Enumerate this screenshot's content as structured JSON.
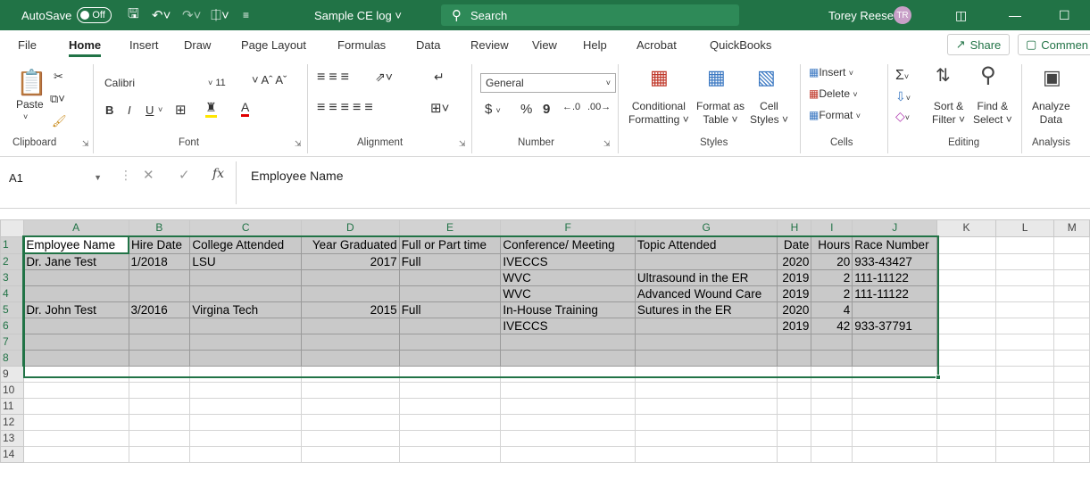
{
  "titlebar": {
    "autosave_label": "AutoSave",
    "autosave_state": "Off",
    "doc_title": "Sample CE log",
    "search_placeholder": "Search",
    "user_name": "Torey Reese",
    "user_initials": "TR"
  },
  "tabs": [
    "File",
    "Home",
    "Insert",
    "Draw",
    "Page Layout",
    "Formulas",
    "Data",
    "Review",
    "View",
    "Help",
    "Acrobat",
    "QuickBooks"
  ],
  "active_tab": "Home",
  "share_label": "Share",
  "comments_label": "Commen",
  "ribbon": {
    "clipboard": {
      "paste": "Paste",
      "label": "Clipboard"
    },
    "font": {
      "name": "Calibri",
      "size": "11",
      "label": "Font",
      "bold": "B",
      "italic": "I",
      "underline": "U"
    },
    "alignment": {
      "label": "Alignment"
    },
    "number": {
      "format": "General",
      "label": "Number",
      "currency": "$",
      "percent": "%",
      "comma": "9"
    },
    "styles": {
      "conditional_1": "Conditional",
      "conditional_2": "Formatting",
      "format_as_1": "Format as",
      "format_as_2": "Table",
      "cell_1": "Cell",
      "cell_2": "Styles",
      "label": "Styles"
    },
    "cells": {
      "insert": "Insert",
      "delete": "Delete",
      "format": "Format",
      "label": "Cells"
    },
    "editing": {
      "sort_1": "Sort &",
      "sort_2": "Filter",
      "find_1": "Find &",
      "find_2": "Select",
      "label": "Editing"
    },
    "analysis": {
      "analyze_1": "Analyze",
      "analyze_2": "Data",
      "label": "Analysis"
    }
  },
  "formula_bar": {
    "name_box": "A1",
    "fx": "fx",
    "content": "Employee Name"
  },
  "sheet": {
    "columns": [
      "A",
      "B",
      "C",
      "D",
      "E",
      "F",
      "G",
      "H",
      "I",
      "J",
      "K",
      "L",
      "M"
    ],
    "rows": [
      {
        "n": "1",
        "cells": [
          "Employee Name",
          "Hire Date",
          "College Attended",
          "Year Graduated",
          "Full or Part time",
          "Conference/ Meeting",
          "Topic Attended",
          "Date",
          "Hours",
          "Race Number"
        ]
      },
      {
        "n": "2",
        "cells": [
          "Dr. Jane Test",
          "1/2018",
          "LSU",
          "2017",
          "Full",
          "IVECCS",
          "",
          "2020",
          "20",
          "933-43427"
        ]
      },
      {
        "n": "3",
        "cells": [
          "",
          "",
          "",
          "",
          "",
          "WVC",
          "Ultrasound in the ER",
          "2019",
          "2",
          "111-11122"
        ]
      },
      {
        "n": "4",
        "cells": [
          "",
          "",
          "",
          "",
          "",
          "WVC",
          "Advanced Wound Care",
          "2019",
          "2",
          "111-11122"
        ]
      },
      {
        "n": "5",
        "cells": [
          "Dr. John Test",
          "3/2016",
          "Virgina Tech",
          "2015",
          "Full",
          "In-House Training",
          "Sutures in the ER",
          "2020",
          "4",
          ""
        ]
      },
      {
        "n": "6",
        "cells": [
          "",
          "",
          "",
          "",
          "",
          "IVECCS",
          "",
          "2019",
          "42",
          "933-37791"
        ]
      },
      {
        "n": "7",
        "cells": [
          "",
          "",
          "",
          "",
          "",
          "",
          "",
          "",
          "",
          ""
        ]
      },
      {
        "n": "8",
        "cells": [
          "",
          "",
          "",
          "",
          "",
          "",
          "",
          "",
          "",
          ""
        ]
      },
      {
        "n": "9",
        "cells": []
      },
      {
        "n": "10",
        "cells": []
      },
      {
        "n": "11",
        "cells": []
      },
      {
        "n": "12",
        "cells": []
      },
      {
        "n": "13",
        "cells": []
      },
      {
        "n": "14",
        "cells": []
      }
    ]
  },
  "colors": {
    "accent": "#217346",
    "selection_fill": "#c9c9c9"
  }
}
